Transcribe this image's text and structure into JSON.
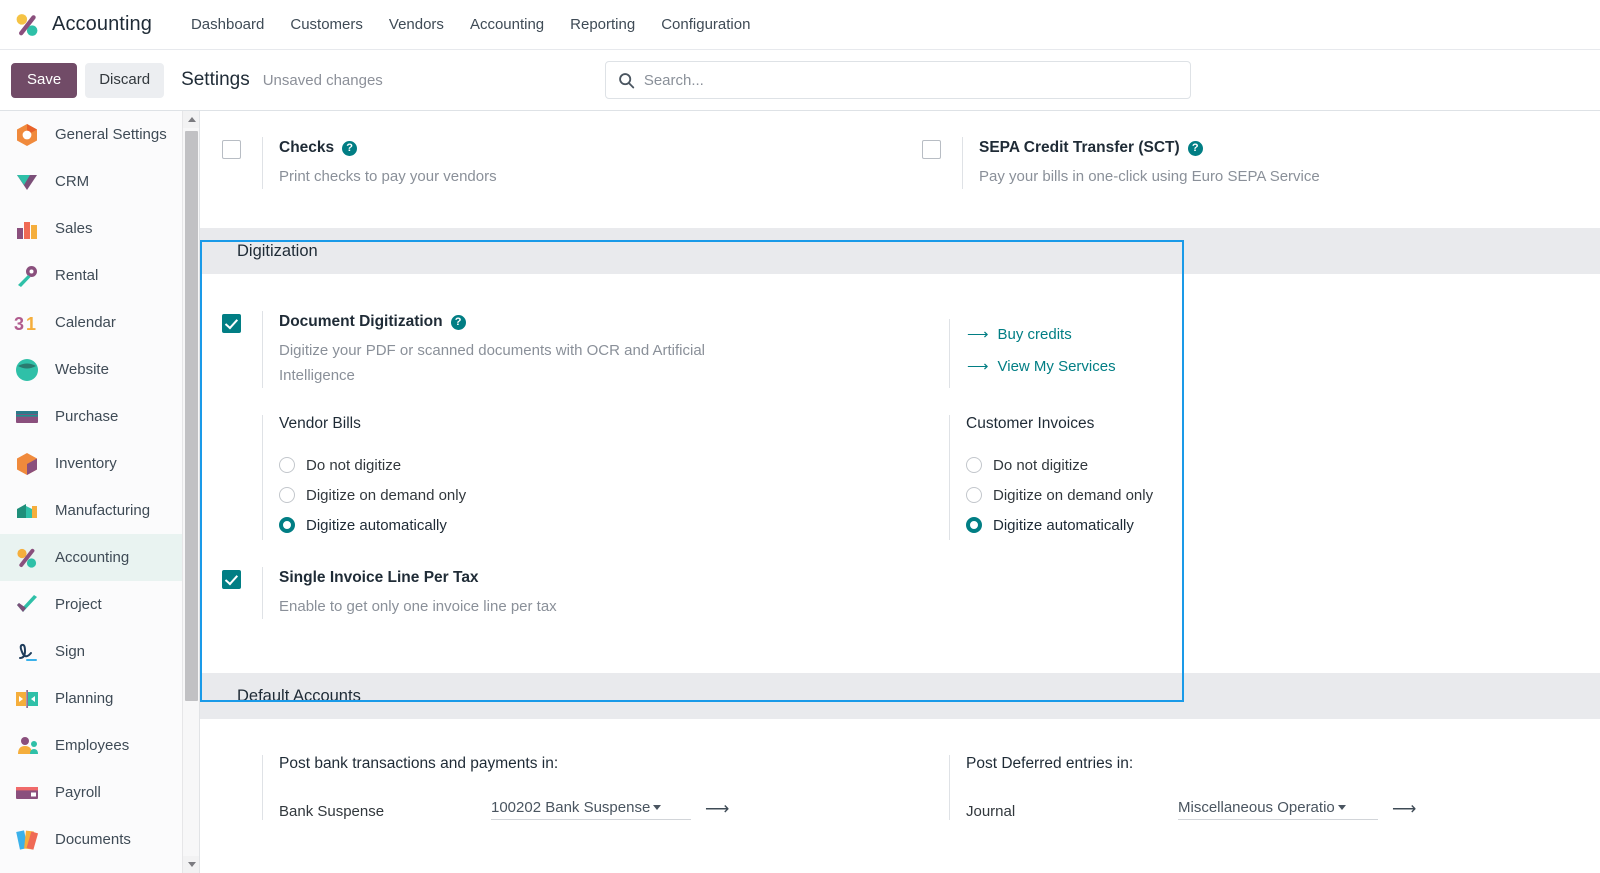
{
  "app": {
    "name": "Accounting",
    "logo_icon": "accounting-percent-logo"
  },
  "navbar": {
    "menus": [
      {
        "label": "Dashboard"
      },
      {
        "label": "Customers"
      },
      {
        "label": "Vendors"
      },
      {
        "label": "Accounting"
      },
      {
        "label": "Reporting"
      },
      {
        "label": "Configuration"
      }
    ]
  },
  "control_panel": {
    "save_label": "Save",
    "discard_label": "Discard",
    "breadcrumb": "Settings",
    "dirty_text": "Unsaved changes",
    "search_placeholder": "Search...",
    "search_value": "",
    "search_icon": "search-icon"
  },
  "sidebar": {
    "items": [
      {
        "label": "General Settings",
        "icon": "general-settings-icon",
        "active": false
      },
      {
        "label": "CRM",
        "icon": "crm-icon",
        "active": false
      },
      {
        "label": "Sales",
        "icon": "sales-icon",
        "active": false
      },
      {
        "label": "Rental",
        "icon": "rental-icon",
        "active": false
      },
      {
        "label": "Calendar",
        "icon": "calendar-icon",
        "active": false
      },
      {
        "label": "Website",
        "icon": "website-icon",
        "active": false
      },
      {
        "label": "Purchase",
        "icon": "purchase-icon",
        "active": false
      },
      {
        "label": "Inventory",
        "icon": "inventory-icon",
        "active": false
      },
      {
        "label": "Manufacturing",
        "icon": "manufacturing-icon",
        "active": false
      },
      {
        "label": "Accounting",
        "icon": "accounting-icon",
        "active": true
      },
      {
        "label": "Project",
        "icon": "project-icon",
        "active": false
      },
      {
        "label": "Sign",
        "icon": "sign-icon",
        "active": false
      },
      {
        "label": "Planning",
        "icon": "planning-icon",
        "active": false
      },
      {
        "label": "Employees",
        "icon": "employees-icon",
        "active": false
      },
      {
        "label": "Payroll",
        "icon": "payroll-icon",
        "active": false
      },
      {
        "label": "Documents",
        "icon": "documents-icon",
        "active": false
      }
    ],
    "scroll_up_icon": "scroll-up-arrow-icon",
    "scroll_down_icon": "scroll-down-arrow-icon"
  },
  "payments": {
    "checks": {
      "title": "Checks",
      "description": "Print checks to pay your vendors",
      "checked": false,
      "help_icon": "help-icon"
    },
    "sepa": {
      "title": "SEPA Credit Transfer (SCT)",
      "description": "Pay your bills in one-click using Euro SEPA Service",
      "checked": false,
      "help_icon": "help-icon"
    }
  },
  "digitization": {
    "section_title": "Digitization",
    "highlighted": true,
    "highlight_color": "#1a9ae8",
    "document_digitization": {
      "title": "Document Digitization",
      "description": "Digitize your PDF or scanned documents with OCR and Artificial Intelligence",
      "checked": true,
      "help_icon": "help-icon"
    },
    "links": [
      {
        "label": "Buy credits",
        "icon": "arrow-right-icon"
      },
      {
        "label": "View My Services",
        "icon": "arrow-right-icon"
      }
    ],
    "vendor_bills": {
      "group_title": "Vendor Bills",
      "options": [
        {
          "label": "Do not digitize",
          "selected": false
        },
        {
          "label": "Digitize on demand only",
          "selected": false
        },
        {
          "label": "Digitize automatically",
          "selected": true
        }
      ]
    },
    "customer_invoices": {
      "group_title": "Customer Invoices",
      "options": [
        {
          "label": "Do not digitize",
          "selected": false
        },
        {
          "label": "Digitize on demand only",
          "selected": false
        },
        {
          "label": "Digitize automatically",
          "selected": true
        }
      ]
    },
    "single_invoice_line": {
      "title": "Single Invoice Line Per Tax",
      "description": "Enable to get only one invoice line per tax",
      "checked": true
    }
  },
  "default_accounts": {
    "section_title": "Default Accounts",
    "bank": {
      "group_title": "Post bank transactions and payments in:",
      "field_label": "Bank Suspense",
      "field_value": "100202 Bank Suspense",
      "caret_icon": "chevron-down-icon",
      "internal_link_icon": "arrow-right-icon"
    },
    "deferred": {
      "group_title": "Post Deferred entries in:",
      "field_label": "Journal",
      "field_value": "Miscellaneous Operatio",
      "caret_icon": "chevron-down-icon",
      "internal_link_icon": "arrow-right-icon"
    }
  },
  "theme": {
    "brand_purple": "#714b67",
    "accent_teal": "#017e84",
    "highlight_blue": "#1a9ae8",
    "band_gray": "#e9eaed"
  }
}
